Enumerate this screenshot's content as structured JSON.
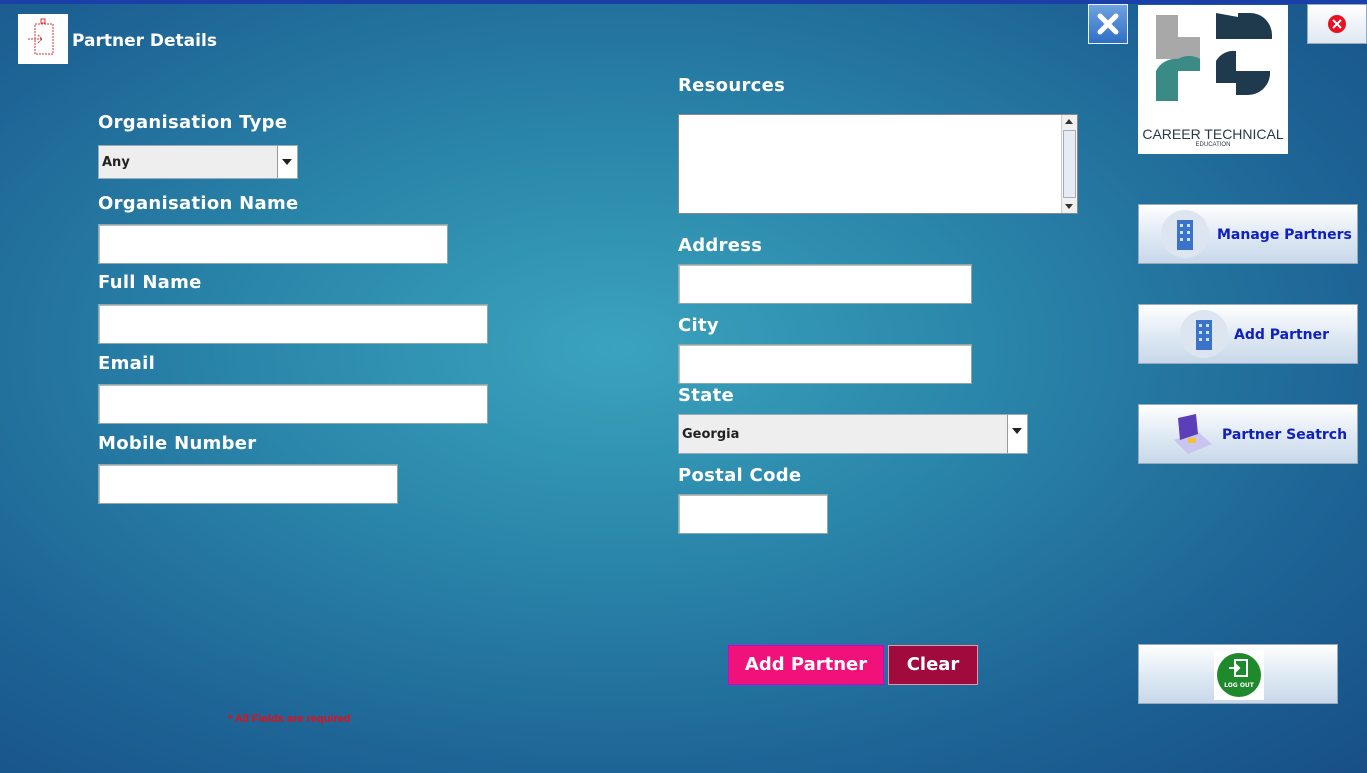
{
  "window": {
    "title": "Partner Details"
  },
  "form": {
    "org_type_label": "Organisation Type",
    "org_type_value": "Any",
    "org_name_label": "Organisation Name",
    "full_name_label": "Full Name",
    "email_label": "Email",
    "mobile_label": "Mobile Number",
    "resources_label": "Resources",
    "address_label": "Address",
    "city_label": "City",
    "state_label": "State",
    "state_value": "Georgia",
    "postal_label": "Postal Code",
    "required_note": "* All Fields are required"
  },
  "actions": {
    "add_label": "Add Partner",
    "clear_label": "Clear"
  },
  "logo": {
    "line1": "CAREER TECHNICAL",
    "line2": "EDUCATION"
  },
  "sidebar": {
    "items": [
      {
        "label": "Manage Partners",
        "icon": "building-icon"
      },
      {
        "label": "Add Partner",
        "icon": "building-icon"
      },
      {
        "label": "Partner Seatrch",
        "icon": "search-laptop-icon"
      }
    ],
    "logout_label": "LOG OUT"
  },
  "colors": {
    "accent_pink": "#f0127a",
    "accent_maroon": "#a00a3c",
    "link_blue": "#1020c0"
  }
}
